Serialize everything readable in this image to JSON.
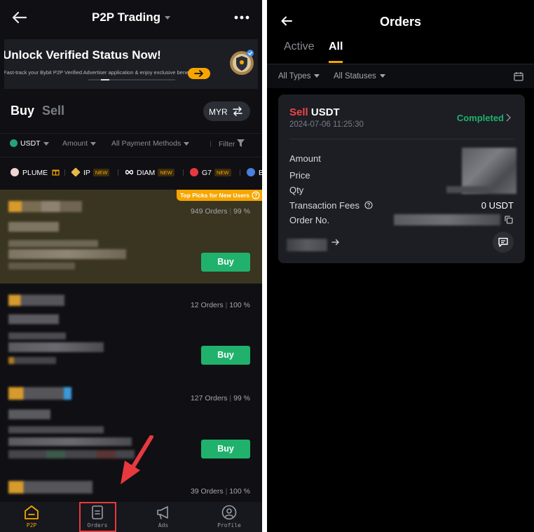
{
  "left": {
    "header": {
      "title": "P2P Trading"
    },
    "banner": {
      "title": "Unlock Verified Status Now!",
      "subtitle": "Fast-track your Bybit P2P Verified Advertiser application & enjoy exclusive benefits."
    },
    "trade_tabs": {
      "buy": "Buy",
      "sell": "Sell"
    },
    "fiat": "MYR",
    "filters": {
      "asset": "USDT",
      "amount": "Amount",
      "payment": "All Payment Methods",
      "filter": "Filter"
    },
    "coins": [
      {
        "label": "PLUME",
        "new": ""
      },
      {
        "label": "IP",
        "new": "NEW"
      },
      {
        "label": "DIAM",
        "new": "NEW"
      },
      {
        "label": "G7",
        "new": "NEW"
      },
      {
        "label": "B",
        "new": ""
      }
    ],
    "listings": [
      {
        "orders": "949 Orders",
        "completion": "99 %",
        "tag": "Top Picks for New Users",
        "action": "Buy"
      },
      {
        "orders": "12 Orders",
        "completion": "100 %",
        "tag": "",
        "action": "Buy"
      },
      {
        "orders": "127 Orders",
        "completion": "99 %",
        "tag": "",
        "action": "Buy"
      },
      {
        "orders": "39 Orders",
        "completion": "100 %",
        "tag": "",
        "action": ""
      }
    ],
    "bottom_nav": [
      {
        "label": "P2P",
        "icon": "home-icon",
        "active": true
      },
      {
        "label": "Orders",
        "icon": "orders-icon",
        "active": false
      },
      {
        "label": "Ads",
        "icon": "megaphone-icon",
        "active": false
      },
      {
        "label": "Profile",
        "icon": "profile-icon",
        "active": false
      }
    ],
    "colors": {
      "accent": "#f7a600",
      "buy": "#20b26c",
      "annotation": "#e8393e"
    }
  },
  "right": {
    "header": {
      "title": "Orders"
    },
    "tabs": {
      "active": "Active",
      "all": "All"
    },
    "filters": {
      "types": "All Types",
      "statuses": "All Statuses"
    },
    "order": {
      "side": "Sell",
      "asset": "USDT",
      "time": "2024-07-06 11:25:30",
      "status": "Completed",
      "labels": {
        "amount": "Amount",
        "price": "Price",
        "qty": "Qty",
        "fees": "Transaction Fees",
        "order_no": "Order No."
      },
      "fees_value": "0 USDT"
    },
    "colors": {
      "sell": "#ef454a",
      "completed": "#20b26c"
    }
  }
}
